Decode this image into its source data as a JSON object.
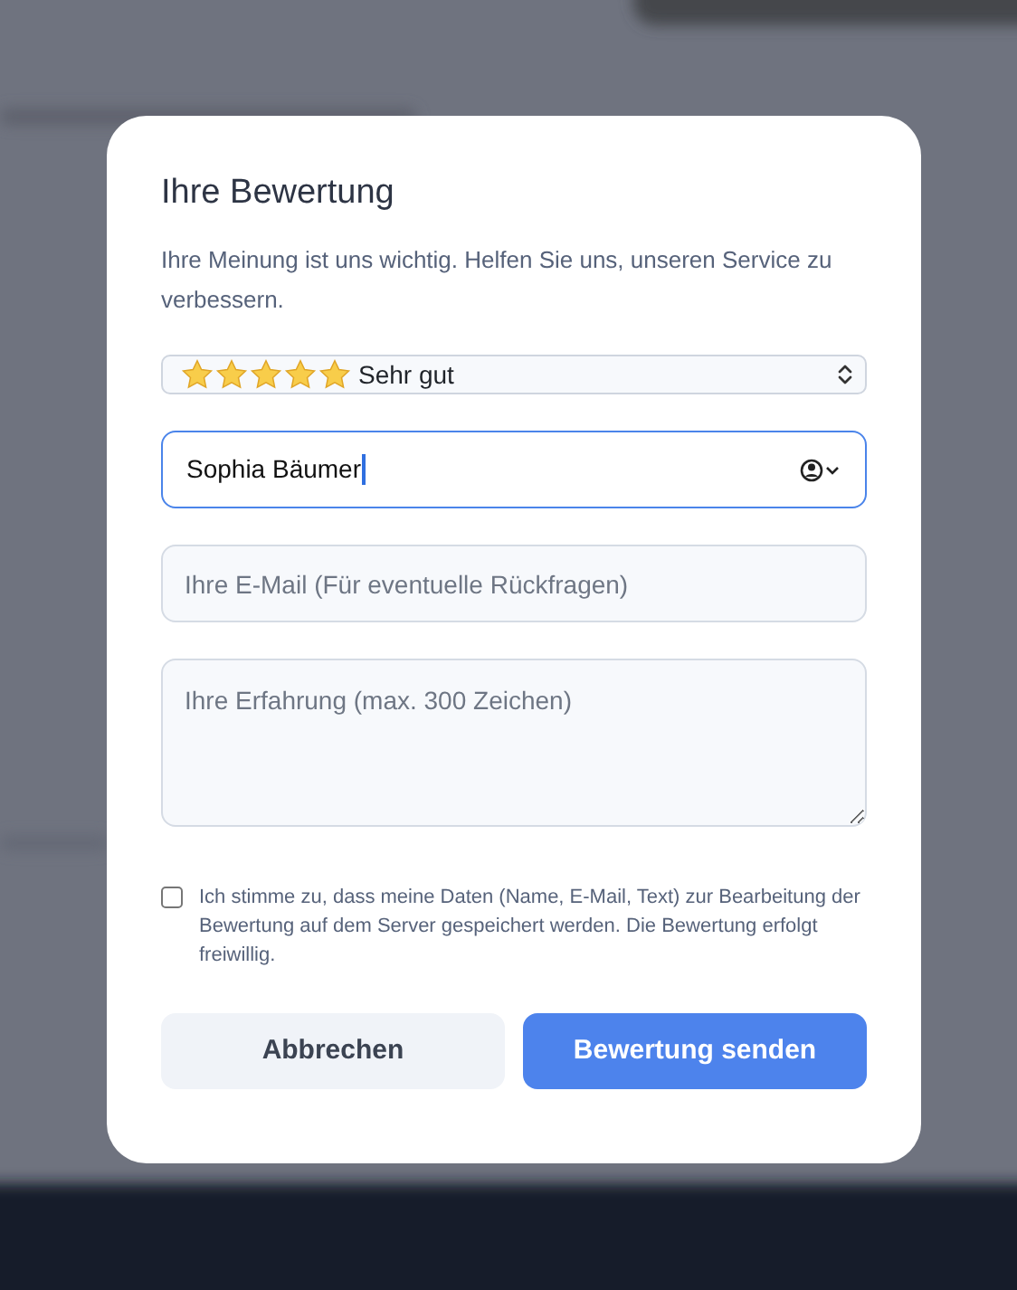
{
  "dialog": {
    "title": "Ihre Bewertung",
    "description": "Ihre Meinung ist uns wichtig. Helfen Sie uns, unseren Service zu verbessern.",
    "rating": {
      "stars": 5,
      "label": "Sehr gut"
    },
    "name_field": {
      "value": "Sophia Bäumer",
      "focused": true
    },
    "email_field": {
      "placeholder": "Ihre E-Mail (Für eventuelle Rückfragen)"
    },
    "experience_field": {
      "placeholder": "Ihre Erfahrung (max. 300 Zeichen)"
    },
    "consent": {
      "checked": false,
      "text": "Ich stimme zu, dass meine Daten (Name, E-Mail, Text) zur Bearbeitung der Bewertung auf dem Server gespeichert werden. Die Bewertung erfolgt freiwillig."
    },
    "buttons": [
      {
        "kind": "secondary",
        "label": "Abbrechen"
      },
      {
        "kind": "primary",
        "label": "Bewertung senden"
      }
    ]
  }
}
